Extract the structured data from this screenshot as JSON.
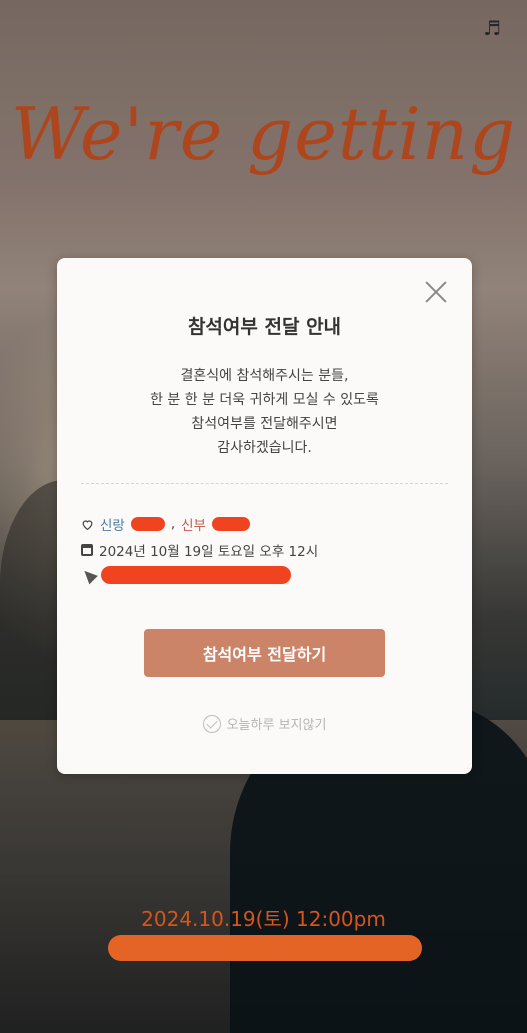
{
  "background": {
    "script_title": "We're getting",
    "date_time": "2024.10.19(토) 12:00pm",
    "music_icon": "music-note-icon"
  },
  "modal": {
    "title": "참석여부 전달 안내",
    "body_lines": [
      "결혼식에 참석해주시는 분들,",
      "한 분 한 분 더욱 귀하게 모실 수 있도록",
      "참석여부를 전달해주시면",
      "감사하겠습니다."
    ],
    "groom_label": "신랑",
    "bride_label": "신부",
    "separator": ",",
    "datetime_text": "2024년 10월 19일 토요일 오후 12시",
    "cta_label": "참석여부 전달하기",
    "skip_label": "오늘하루 보지않기"
  },
  "colors": {
    "accent": "#cc8468",
    "groom": "#4a7fa0",
    "bride": "#c25a4a",
    "script": "#b84a1f",
    "date": "#e05a20"
  }
}
